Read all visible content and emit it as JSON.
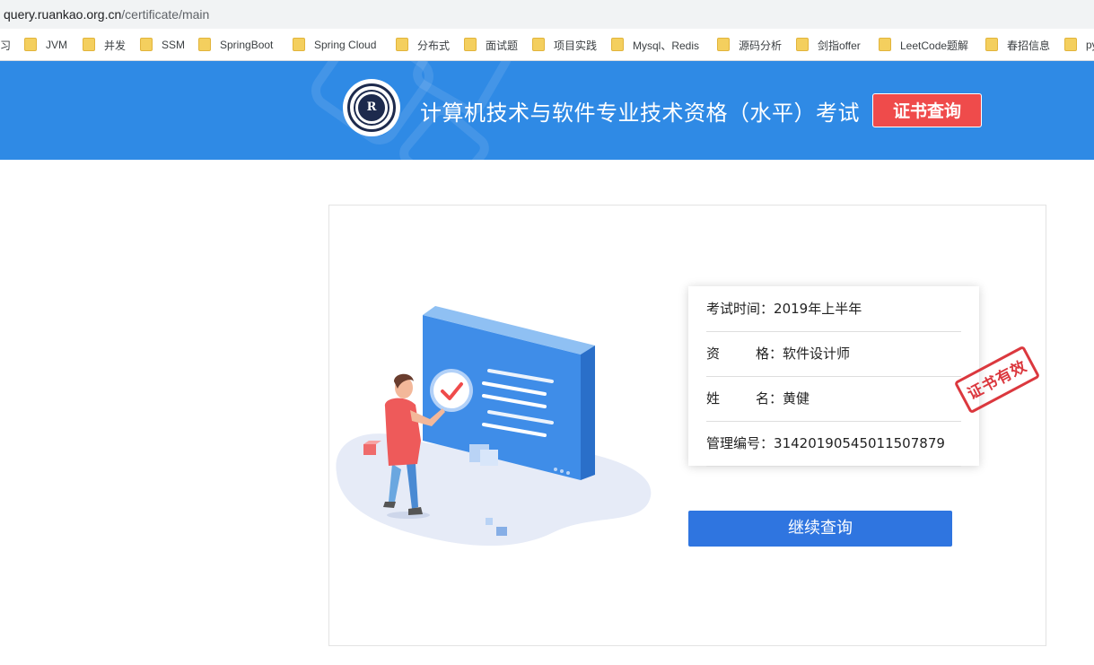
{
  "browser": {
    "url_host": "query.ruankao.org.cn",
    "url_path": "/certificate/main",
    "bookmarks": [
      {
        "label": "习",
        "icon": "none"
      },
      {
        "label": "JVM",
        "icon": "folder-icon"
      },
      {
        "label": "并发",
        "icon": "folder-icon"
      },
      {
        "label": "SSM",
        "icon": "folder-icon"
      },
      {
        "label": "SpringBoot",
        "icon": "folder-icon"
      },
      {
        "label": "Spring Cloud",
        "icon": "folder-icon"
      },
      {
        "label": "分布式",
        "icon": "folder-icon"
      },
      {
        "label": "面试题",
        "icon": "folder-icon"
      },
      {
        "label": "项目实践",
        "icon": "folder-icon"
      },
      {
        "label": "Mysql、Redis",
        "icon": "folder-icon"
      },
      {
        "label": "源码分析",
        "icon": "folder-icon"
      },
      {
        "label": "剑指offer",
        "icon": "folder-icon"
      },
      {
        "label": "LeetCode题解",
        "icon": "folder-icon"
      },
      {
        "label": "春招信息",
        "icon": "folder-icon"
      },
      {
        "label": "py",
        "icon": "folder-icon"
      }
    ]
  },
  "header": {
    "logo_letter": "R",
    "title": "计算机技术与软件专业技术资格（水平）考试",
    "cert_query_button": "证书查询",
    "colors": {
      "banner": "#2f8ae5",
      "button": "#ef4b4b"
    }
  },
  "result": {
    "rows": [
      {
        "label": "考试时间",
        "value": "2019年上半年"
      },
      {
        "label_chars": [
          "资",
          "格"
        ],
        "value": "软件设计师"
      },
      {
        "label_chars": [
          "姓",
          "名"
        ],
        "value": "黄健"
      },
      {
        "label": "管理编号",
        "value": "31420190545011507879"
      }
    ],
    "colon": "：",
    "stamp_text": "证书有效",
    "continue_button": "继续查询",
    "colors": {
      "stamp": "#d8232a",
      "continue": "#2f75e0"
    }
  }
}
